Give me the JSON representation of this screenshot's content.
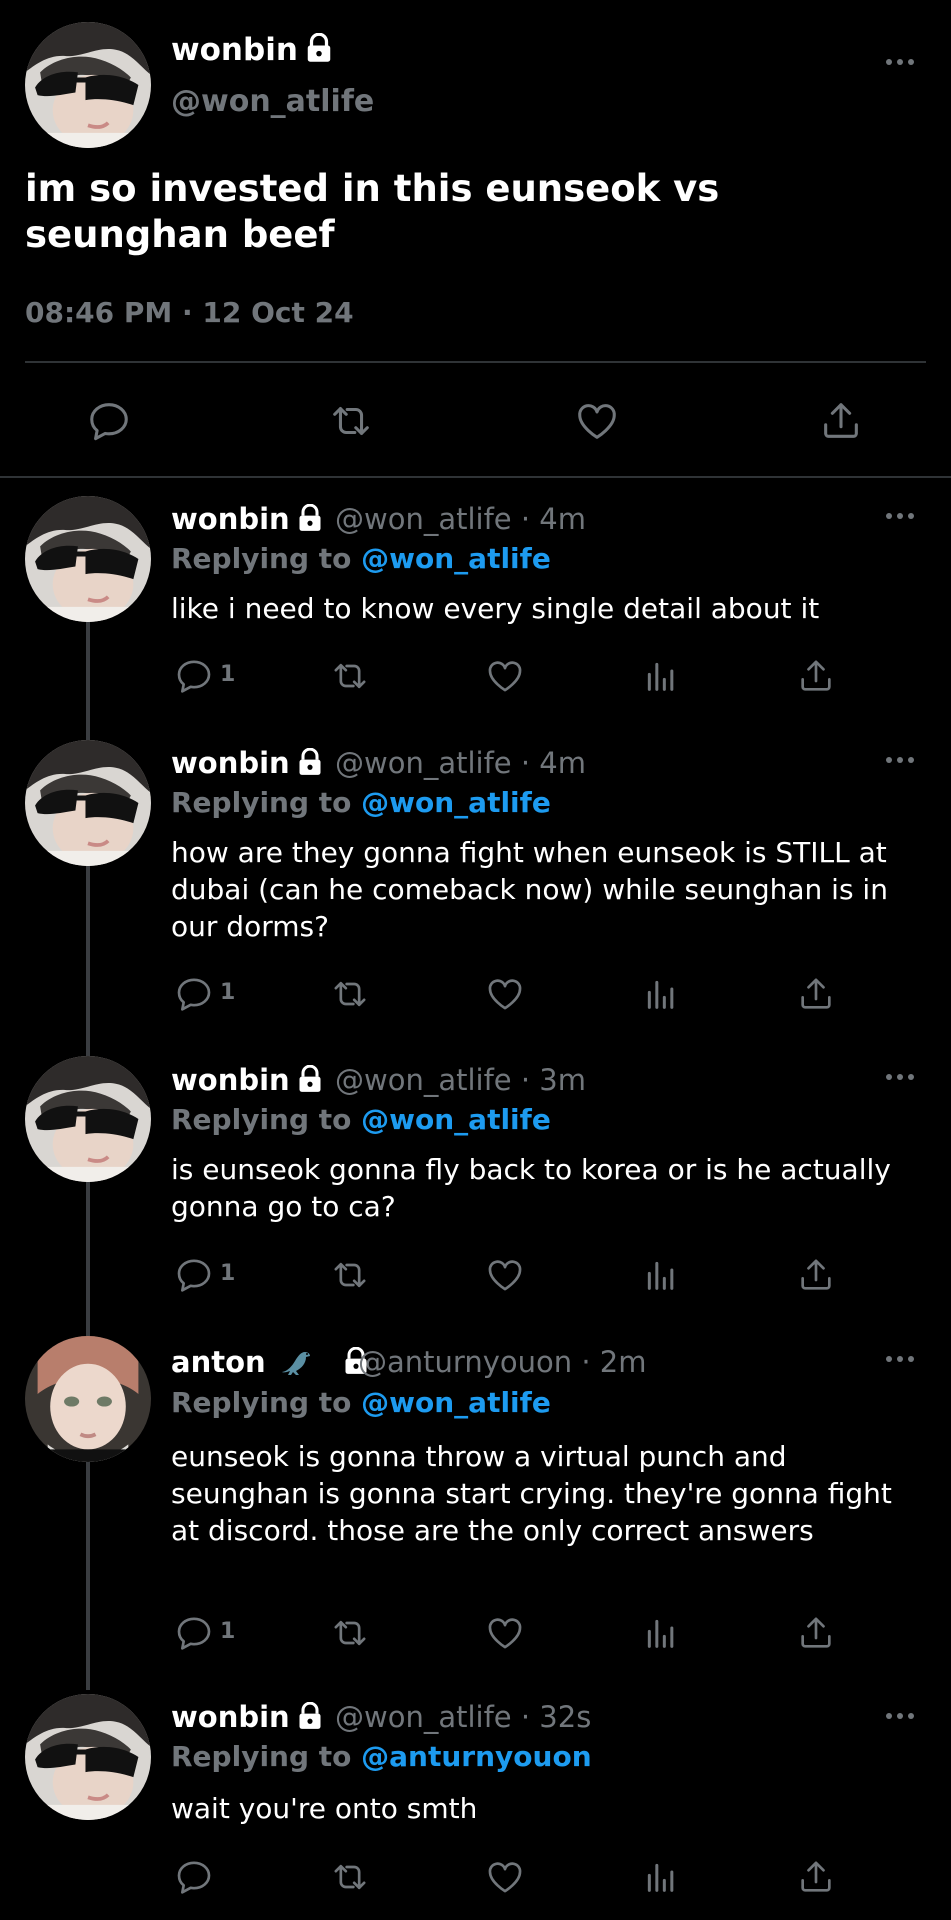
{
  "main_tweet": {
    "name": "wonbin",
    "handle": "@won_atlife",
    "text": "im so invested in this eunseok vs seunghan beef",
    "timestamp": "08:46 PM · 12 Oct 24"
  },
  "replies": [
    {
      "name": "wonbin",
      "meta": "@won_atlife · 4m",
      "replying_label": "Replying to",
      "replying_to": "@won_atlife",
      "text": "like i need to know every single detail about it",
      "reply_count": "1"
    },
    {
      "name": "wonbin",
      "meta": "@won_atlife · 4m",
      "replying_label": "Replying to",
      "replying_to": "@won_atlife",
      "text": "how are they gonna fight when eunseok is STILL at dubai (can he comeback now) while seunghan is in our dorms?",
      "reply_count": "1"
    },
    {
      "name": "wonbin",
      "meta": "@won_atlife · 3m",
      "replying_label": "Replying to",
      "replying_to": "@won_atlife",
      "text": "is eunseok gonna fly back to korea or is he actually gonna go to ca?",
      "reply_count": "1"
    },
    {
      "name": "anton",
      "meta": "@anturnyouon · 2m",
      "replying_label": "Replying to",
      "replying_to": "@won_atlife",
      "text": "eunseok is gonna throw a virtual punch and seunghan is gonna start crying. they're gonna fight at discord. those are the only correct answers",
      "reply_count": "1"
    },
    {
      "name": "wonbin",
      "meta": "@won_atlife · 32s",
      "replying_label": "Replying to",
      "replying_to": "@anturnyouon",
      "text": "wait you're onto smth",
      "reply_count": ""
    }
  ],
  "colors": {
    "background": "#000000",
    "text": "#ffffff",
    "muted": "#71767b",
    "accent": "#1d9bf0",
    "divider": "#2f3336"
  },
  "icons": [
    "lock-icon",
    "more-icon",
    "reply-icon",
    "retweet-icon",
    "like-icon",
    "views-icon",
    "share-icon",
    "dinosaur-emoji"
  ]
}
